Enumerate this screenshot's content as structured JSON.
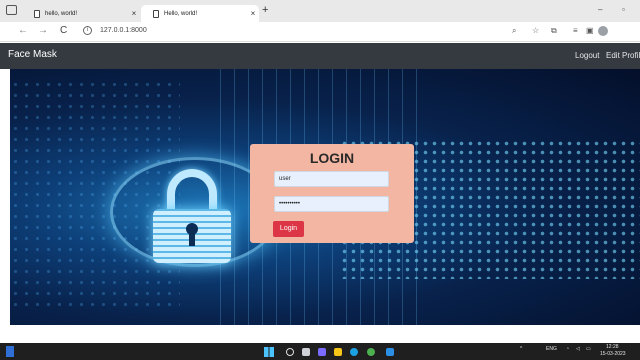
{
  "browser": {
    "tabs": [
      {
        "title": "hello, world!",
        "close": "×",
        "active": false
      },
      {
        "title": "Hello, world!",
        "close": "×",
        "active": true
      }
    ],
    "new_tab": "+",
    "window_controls": {
      "minimize": "–",
      "restore": "▫"
    },
    "url": "127.0.0.1:8000",
    "nav": {
      "back": "←",
      "forward": "→",
      "reload": "C"
    },
    "toolbar_icons": [
      "read-aloud-icon",
      "favorites-icon",
      "collections-icon",
      "settings-icon",
      "profile-icon"
    ]
  },
  "navbar": {
    "brand": "Face Mask",
    "links": [
      "Logout",
      "Edit Profile"
    ],
    "bg_color": "#343a40"
  },
  "login": {
    "title": "LOGIN",
    "username_value": "user",
    "password_value": "••••••••••",
    "button_label": "Login",
    "card_color": "#f2b6a3",
    "button_color": "#dc3545"
  },
  "taskbar": {
    "lang": "ENG",
    "time": "12:28",
    "date": "15-03-2023",
    "tray_chevron": "^"
  }
}
